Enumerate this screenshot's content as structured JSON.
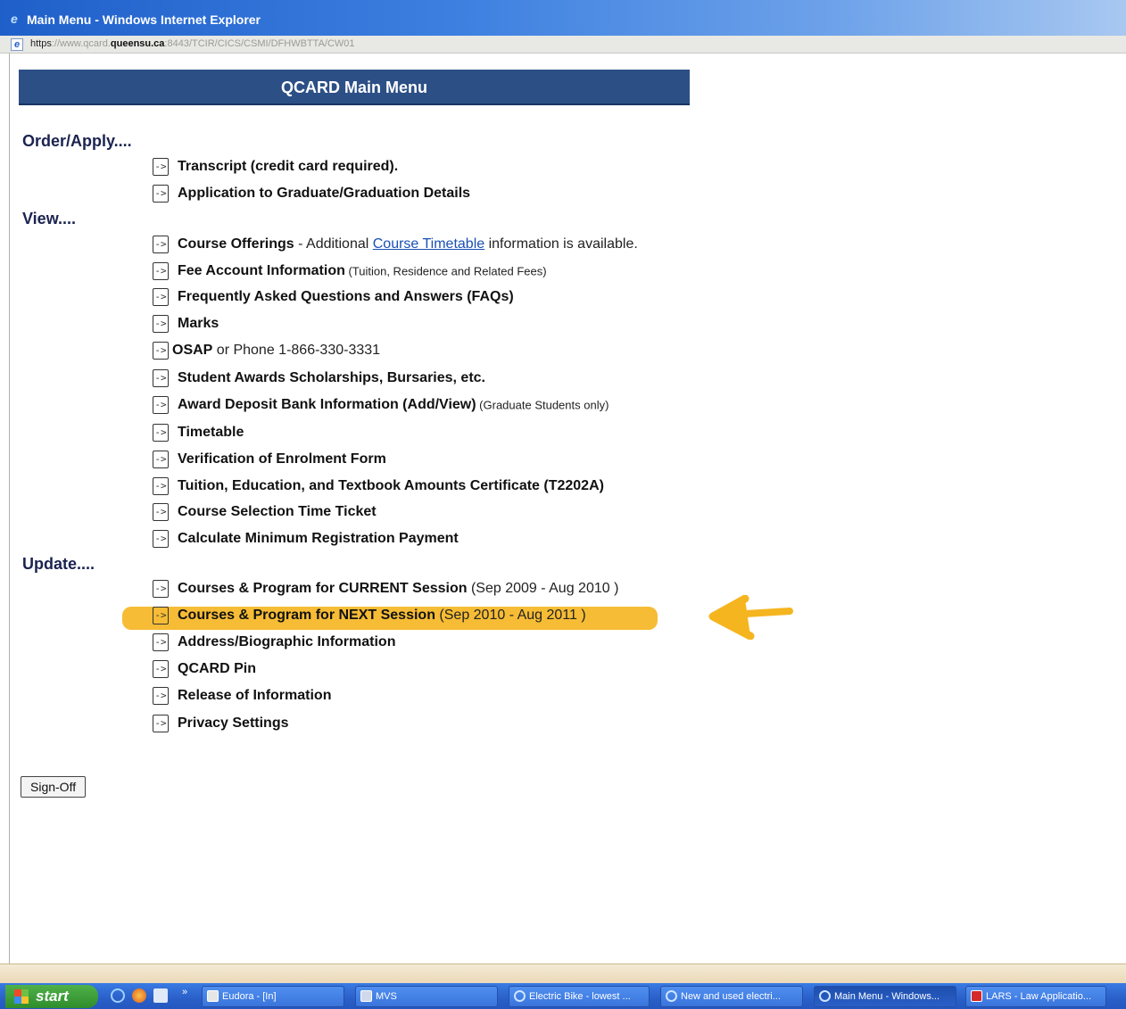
{
  "window": {
    "title": "Main Menu - Windows Internet Explorer"
  },
  "address": {
    "scheme": "https",
    "prefix_dim": "://www.qcard.",
    "host": "queensu.ca",
    "path_dim": ":8443/TCIR/CICS/CSMI/DFHWBTTA/CW01"
  },
  "page": {
    "header": "QCARD Main Menu",
    "sections": {
      "order": "Order/Apply....",
      "view": "View....",
      "update": "Update...."
    },
    "order_items": [
      {
        "label": "Transcript (credit card required)."
      },
      {
        "label": "Application to Graduate/Graduation Details"
      }
    ],
    "view_items": [
      {
        "label": "Course Offerings",
        "extra_pre": " - Additional ",
        "link": "Course Timetable",
        "extra_post": " information is available."
      },
      {
        "label": "Fee Account Information",
        "small": " (Tuition, Residence and Related Fees)"
      },
      {
        "label": "Frequently Asked Questions and Answers (FAQs)"
      },
      {
        "label": "Marks"
      },
      {
        "label": "OSAP",
        "extra": " or Phone 1-866-330-3331"
      },
      {
        "label": "Student Awards Scholarships, Bursaries, etc."
      },
      {
        "label": "Award Deposit Bank Information (Add/View)",
        "small": " (Graduate Students only)"
      },
      {
        "label": "Timetable"
      },
      {
        "label": "Verification of Enrolment Form"
      },
      {
        "label": "Tuition, Education, and Textbook Amounts Certificate (T2202A)"
      },
      {
        "label": "Course Selection Time Ticket"
      },
      {
        "label": "Calculate Minimum Registration Payment"
      }
    ],
    "update_items": [
      {
        "label": "Courses & Program for CURRENT Session",
        "extra": " (Sep 2009 - Aug 2010 )"
      },
      {
        "label": "Courses & Program for NEXT Session",
        "extra": " (Sep 2010 - Aug 2011 )"
      },
      {
        "label": "Address/Biographic Information"
      },
      {
        "label": "QCARD Pin"
      },
      {
        "label": "Release of Information"
      },
      {
        "label": "Privacy Settings"
      }
    ],
    "signoff": "Sign-Off",
    "arrow_glyph": "->"
  },
  "annotation": {
    "highlight_color": "#f5b51f",
    "arrow_color": "#f5b51f"
  },
  "taskbar": {
    "start": "start",
    "quick_more": "»",
    "tasks": [
      {
        "label": "Eudora - [In]"
      },
      {
        "label": "MVS"
      },
      {
        "label": "Electric Bike - lowest ..."
      },
      {
        "label": "New and used electri..."
      },
      {
        "label": "Main Menu - Windows..."
      },
      {
        "label": "LARS - Law Applicatio..."
      }
    ]
  }
}
